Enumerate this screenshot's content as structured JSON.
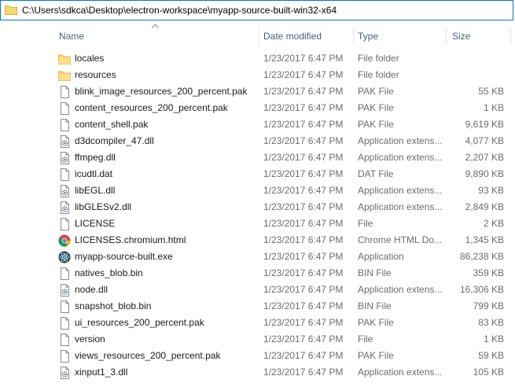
{
  "address": {
    "path": "C:\\Users\\sdkca\\Desktop\\electron-workspace\\myapp-source-built-win32-x64"
  },
  "columns": {
    "name": "Name",
    "date_modified": "Date modified",
    "type": "Type",
    "size": "Size"
  },
  "sort": {
    "column": "name",
    "direction": "ascending",
    "icon": "sort-up-chevron-icon"
  },
  "colors": {
    "accent": "#0078d7",
    "folder": "#f8d775",
    "header_text": "#4c607a",
    "meta_text": "#6d6d6d"
  },
  "files": [
    {
      "name": "locales",
      "date": "1/23/2017 6:47 PM",
      "type": "File folder",
      "size": "",
      "icon": "folder-icon"
    },
    {
      "name": "resources",
      "date": "1/23/2017 6:47 PM",
      "type": "File folder",
      "size": "",
      "icon": "folder-icon"
    },
    {
      "name": "blink_image_resources_200_percent.pak",
      "date": "1/23/2017 6:47 PM",
      "type": "PAK File",
      "size": "55 KB",
      "icon": "file-icon"
    },
    {
      "name": "content_resources_200_percent.pak",
      "date": "1/23/2017 6:47 PM",
      "type": "PAK File",
      "size": "1 KB",
      "icon": "file-icon"
    },
    {
      "name": "content_shell.pak",
      "date": "1/23/2017 6:47 PM",
      "type": "PAK File",
      "size": "9,619 KB",
      "icon": "file-icon"
    },
    {
      "name": "d3dcompiler_47.dll",
      "date": "1/23/2017 6:47 PM",
      "type": "Application extens...",
      "size": "4,077 KB",
      "icon": "dll-gear-icon"
    },
    {
      "name": "ffmpeg.dll",
      "date": "1/23/2017 6:47 PM",
      "type": "Application extens...",
      "size": "2,207 KB",
      "icon": "dll-gear-icon"
    },
    {
      "name": "icudtl.dat",
      "date": "1/23/2017 6:47 PM",
      "type": "DAT File",
      "size": "9,890 KB",
      "icon": "file-icon"
    },
    {
      "name": "libEGL.dll",
      "date": "1/23/2017 6:47 PM",
      "type": "Application extens...",
      "size": "93 KB",
      "icon": "dll-gear-icon"
    },
    {
      "name": "libGLESv2.dll",
      "date": "1/23/2017 6:47 PM",
      "type": "Application extens...",
      "size": "2,849 KB",
      "icon": "dll-gear-icon"
    },
    {
      "name": "LICENSE",
      "date": "1/23/2017 6:47 PM",
      "type": "File",
      "size": "2 KB",
      "icon": "file-icon"
    },
    {
      "name": "LICENSES.chromium.html",
      "date": "1/23/2017 6:47 PM",
      "type": "Chrome HTML Do...",
      "size": "1,345 KB",
      "icon": "chrome-icon"
    },
    {
      "name": "myapp-source-built.exe",
      "date": "1/23/2017 6:47 PM",
      "type": "Application",
      "size": "86,238 KB",
      "icon": "electron-app-icon"
    },
    {
      "name": "natives_blob.bin",
      "date": "1/23/2017 6:47 PM",
      "type": "BIN File",
      "size": "359 KB",
      "icon": "file-icon"
    },
    {
      "name": "node.dll",
      "date": "1/23/2017 6:47 PM",
      "type": "Application extens...",
      "size": "16,306 KB",
      "icon": "dll-gear-icon"
    },
    {
      "name": "snapshot_blob.bin",
      "date": "1/23/2017 6:47 PM",
      "type": "BIN File",
      "size": "799 KB",
      "icon": "file-icon"
    },
    {
      "name": "ui_resources_200_percent.pak",
      "date": "1/23/2017 6:47 PM",
      "type": "PAK File",
      "size": "83 KB",
      "icon": "file-icon"
    },
    {
      "name": "version",
      "date": "1/23/2017 6:47 PM",
      "type": "File",
      "size": "1 KB",
      "icon": "file-icon"
    },
    {
      "name": "views_resources_200_percent.pak",
      "date": "1/23/2017 6:47 PM",
      "type": "PAK File",
      "size": "59 KB",
      "icon": "file-icon"
    },
    {
      "name": "xinput1_3.dll",
      "date": "1/23/2017 6:47 PM",
      "type": "Application extens...",
      "size": "105 KB",
      "icon": "dll-gear-icon"
    }
  ]
}
